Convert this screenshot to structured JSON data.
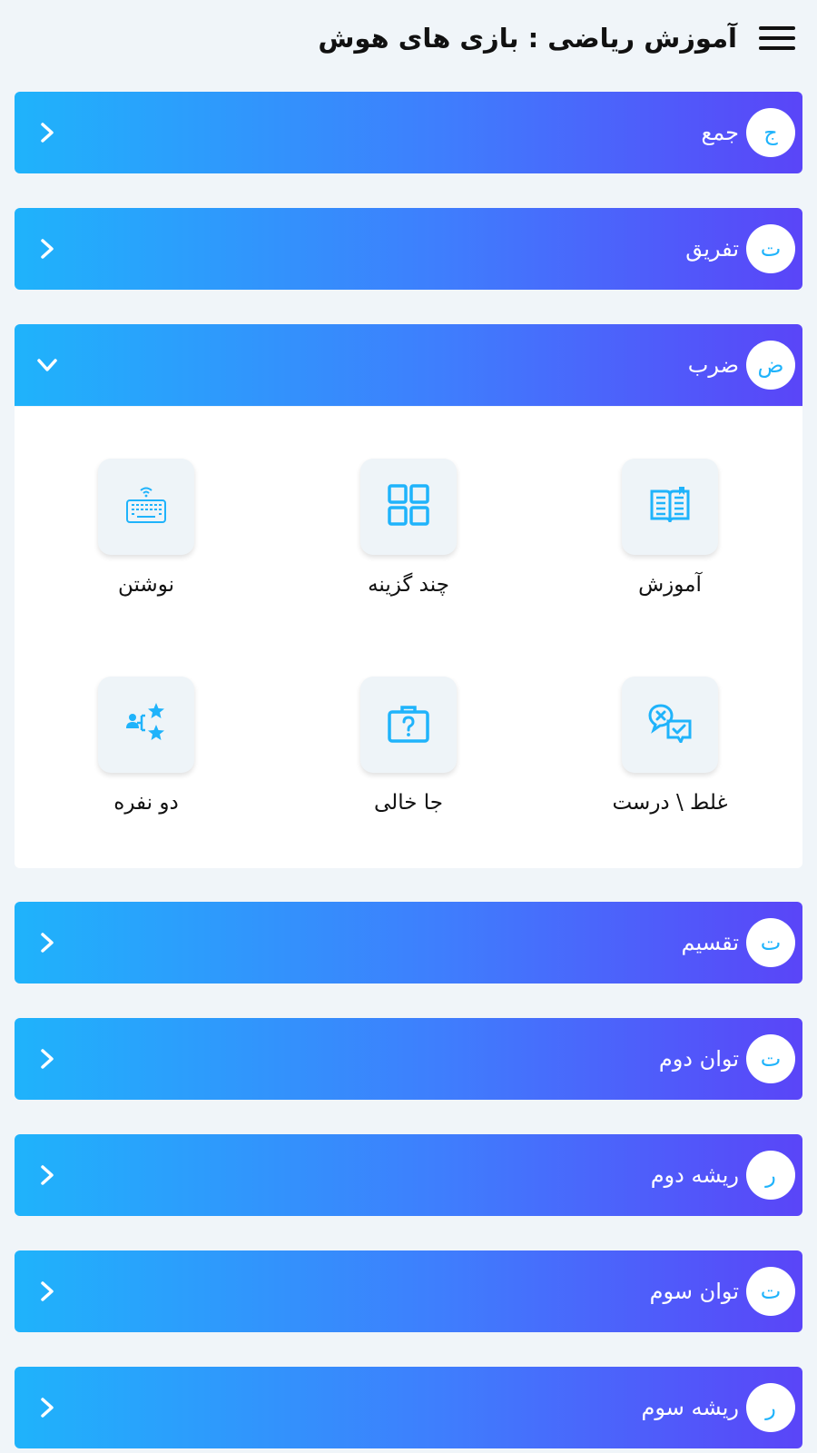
{
  "header": {
    "title": "آموزش ریاضی : بازی های هوش",
    "menu_icon": "hamburger-icon"
  },
  "colors": {
    "gradient_start": "#1fb3fb",
    "gradient_end": "#5a45f8",
    "badge_text": "#1fb3fb",
    "icon": "#1fb3fb"
  },
  "sections": [
    {
      "badge": "ج",
      "label": "جمع",
      "expanded": false
    },
    {
      "badge": "ت",
      "label": "تفریق",
      "expanded": false
    },
    {
      "badge": "ض",
      "label": "ضرب",
      "expanded": true
    },
    {
      "badge": "ت",
      "label": "تقسیم",
      "expanded": false
    },
    {
      "badge": "ت",
      "label": "توان دوم",
      "expanded": false
    },
    {
      "badge": "ر",
      "label": "ریشه دوم",
      "expanded": false
    },
    {
      "badge": "ت",
      "label": "توان سوم",
      "expanded": false
    },
    {
      "badge": "ر",
      "label": "ریشه سوم",
      "expanded": false
    }
  ],
  "activities": [
    {
      "label": "آموزش",
      "icon": "book-icon"
    },
    {
      "label": "چند گزینه",
      "icon": "grid-icon"
    },
    {
      "label": "نوشتن",
      "icon": "keyboard-icon"
    },
    {
      "label": "غلط \\ درست",
      "icon": "chat-check-icon"
    },
    {
      "label": "جا خالی",
      "icon": "question-box-icon"
    },
    {
      "label": "دو نفره",
      "icon": "two-player-icon"
    }
  ]
}
